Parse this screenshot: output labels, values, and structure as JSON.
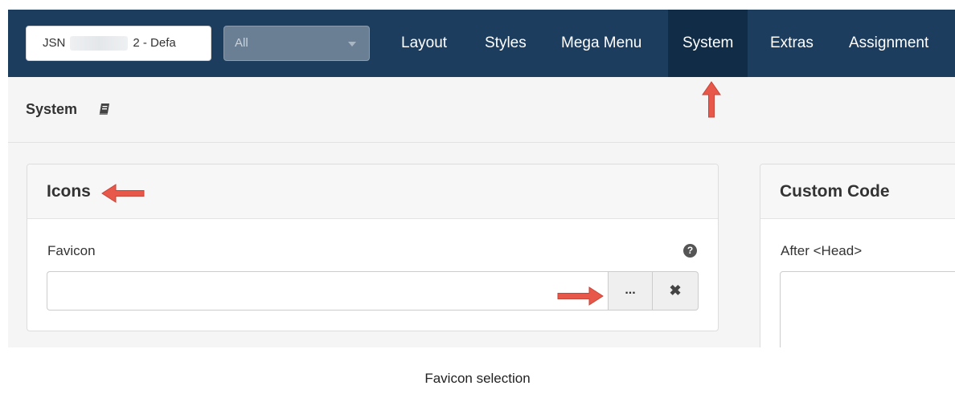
{
  "header": {
    "template_select_prefix": "JSN",
    "template_select_suffix": "2 - Defa",
    "filter_select_value": "All"
  },
  "nav": {
    "items": [
      "Layout",
      "Styles",
      "Mega Menu",
      "System",
      "Extras",
      "Assignment"
    ],
    "active": "System"
  },
  "page": {
    "title": "System"
  },
  "icons_panel": {
    "title": "Icons",
    "favicon_label": "Favicon",
    "favicon_value": "",
    "help_glyph": "?",
    "browse_label": "...",
    "clear_glyph": "✖"
  },
  "custom_code_panel": {
    "title": "Custom Code",
    "after_head_label": "After <Head>",
    "after_head_value": ""
  },
  "caption": "Favicon selection",
  "colors": {
    "navbar": "#1d3d5f",
    "nav_active": "#112c47",
    "annotation_arrow": "#e8584a"
  },
  "icons": {
    "title_icon": "book-icon",
    "help_icon": "question-circle-icon",
    "clear_icon": "close-icon",
    "select_caret": "caret-down-icon"
  }
}
